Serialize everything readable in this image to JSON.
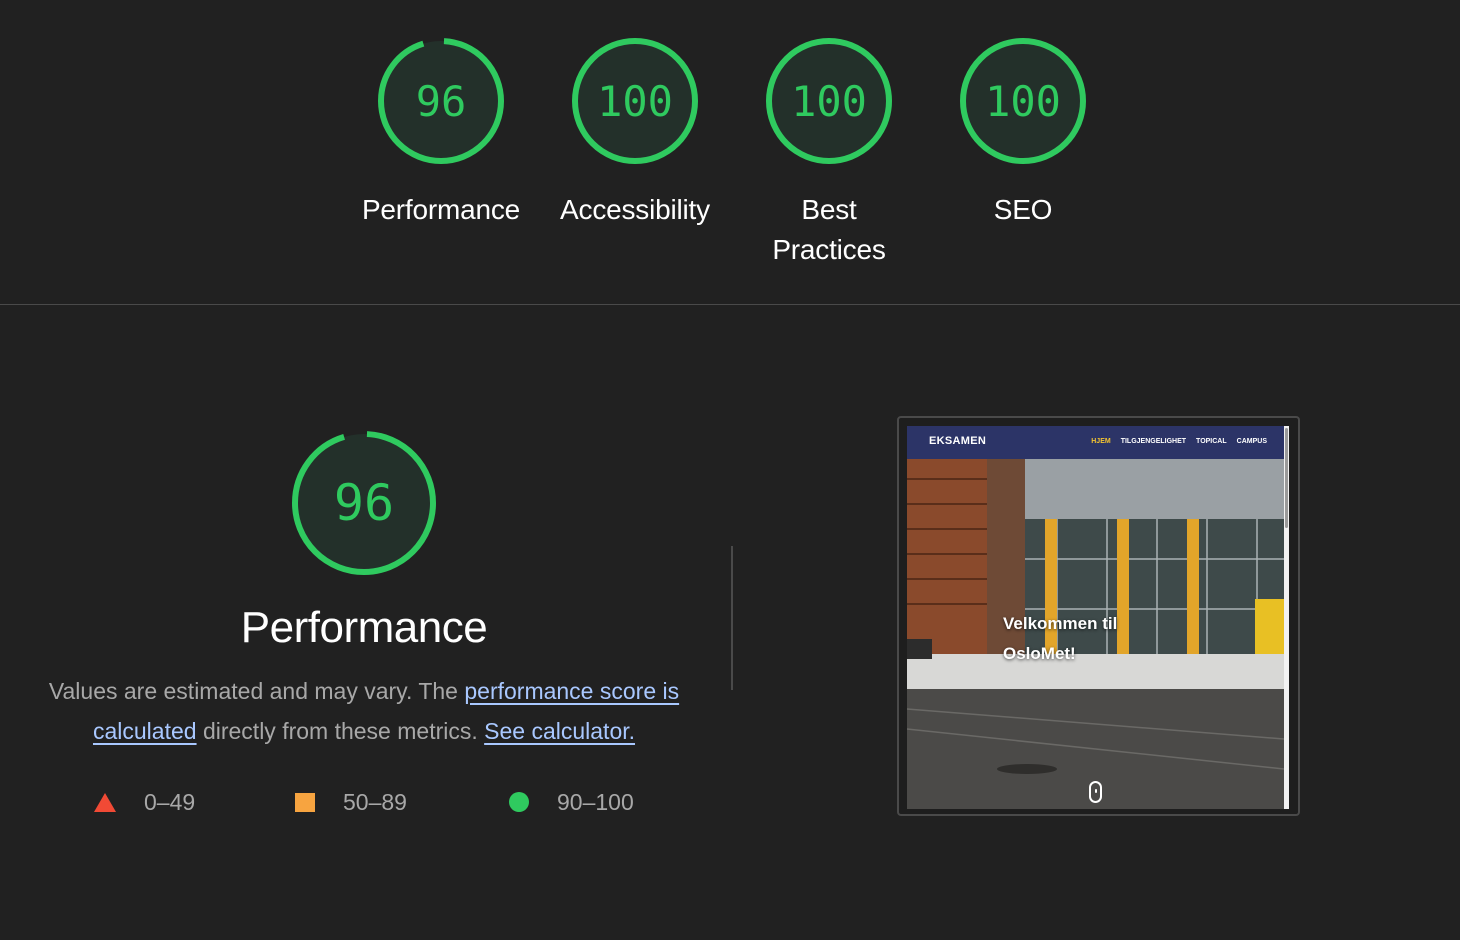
{
  "categories": [
    {
      "id": "performance",
      "score": "96",
      "label": "Performance",
      "fraction": 0.96
    },
    {
      "id": "accessibility",
      "score": "100",
      "label": "Accessibility",
      "fraction": 1.0
    },
    {
      "id": "best-practices",
      "score": "100",
      "label": "Best Practices",
      "fraction": 1.0
    },
    {
      "id": "seo",
      "score": "100",
      "label": "SEO",
      "fraction": 1.0
    }
  ],
  "performance_section": {
    "score": "96",
    "fraction": 0.96,
    "title": "Performance",
    "desc_prefix": "Values are estimated and may vary. The ",
    "desc_link": "performance score is calculated",
    "desc_middle": " directly from these metrics. ",
    "calc_link": "See calculator."
  },
  "legend": [
    {
      "range": "0–49",
      "shape": "triangle",
      "color": "#f14a35"
    },
    {
      "range": "50–89",
      "shape": "square",
      "color": "#f7a440"
    },
    {
      "range": "90–100",
      "shape": "circle",
      "color": "#2fca5f"
    }
  ],
  "screenshot": {
    "site_logo": "EKSAMEN",
    "nav_links": [
      "HJEM",
      "TILGJENGELIGHET",
      "TOPICAL",
      "CAMPUS"
    ],
    "hero_title": "Velkommen til OsloMet!"
  },
  "colors": {
    "background": "#212121",
    "pass_green": "#2fca5f",
    "gauge_fill": "#23302a",
    "link": "#a9c8ff"
  }
}
